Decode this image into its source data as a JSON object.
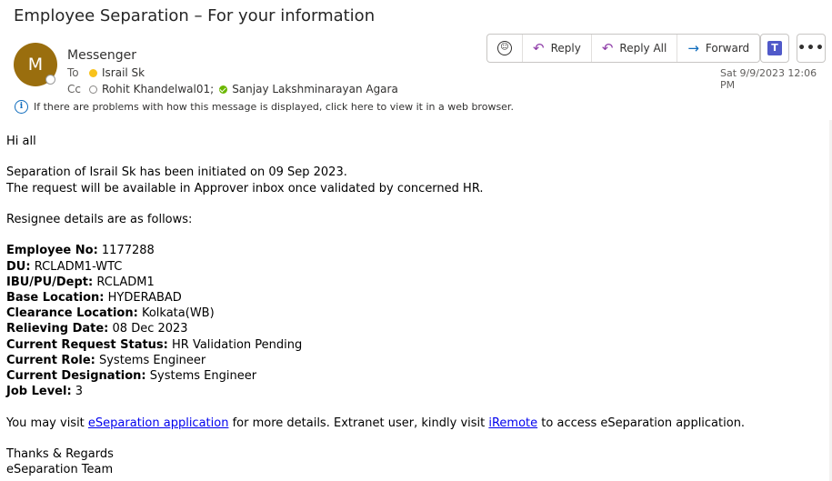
{
  "subject": "Employee Separation – For your information",
  "sender": {
    "initial": "M",
    "name": "Messenger"
  },
  "recipients": {
    "to_label": "To",
    "to": "Israil Sk",
    "cc_label": "Cc",
    "cc": [
      "Rohit Khandelwal01;",
      "Sanjay Lakshminarayan Agara"
    ]
  },
  "info_bar": "If there are problems with how this message is displayed, click here to view it in a web browser.",
  "toolbar": {
    "reply": "Reply",
    "reply_all": "Reply All",
    "forward": "Forward"
  },
  "date": "Sat 9/9/2023 12:06 PM",
  "body": {
    "greeting": "Hi all",
    "line1": "Separation of Israil Sk has been initiated on 09 Sep 2023.",
    "line2": "The request will be available in Approver inbox once validated by concerned HR.",
    "resignee_intro": "Resignee details are as follows:",
    "details": [
      {
        "label": "Employee No:",
        "value": "1177288"
      },
      {
        "label": "DU:",
        "value": "RCLADM1-WTC"
      },
      {
        "label": "IBU/PU/Dept:",
        "value": "RCLADM1"
      },
      {
        "label": "Base Location:",
        "value": "HYDERABAD"
      },
      {
        "label": "Clearance Location:",
        "value": "Kolkata(WB)"
      },
      {
        "label": "Relieving Date:",
        "value": "08 Dec 2023"
      },
      {
        "label": "Current Request Status:",
        "value": "HR Validation Pending"
      },
      {
        "label": "Current Role:",
        "value": "Systems Engineer"
      },
      {
        "label": "Current Designation:",
        "value": "Systems Engineer"
      },
      {
        "label": "Job Level:",
        "value": "3"
      }
    ],
    "visit_prefix": "You may visit ",
    "link1": "eSeparation application",
    "visit_middle": " for more details. Extranet user, kindly visit ",
    "link2": "iRemote",
    "visit_suffix": " to access eSeparation application.",
    "closing": "Thanks & Regards",
    "signature": "eSeparation Team"
  },
  "colors": {
    "avatar": "#9a6e0e",
    "link": "#0000ee",
    "accent": "#0f6cbd"
  }
}
